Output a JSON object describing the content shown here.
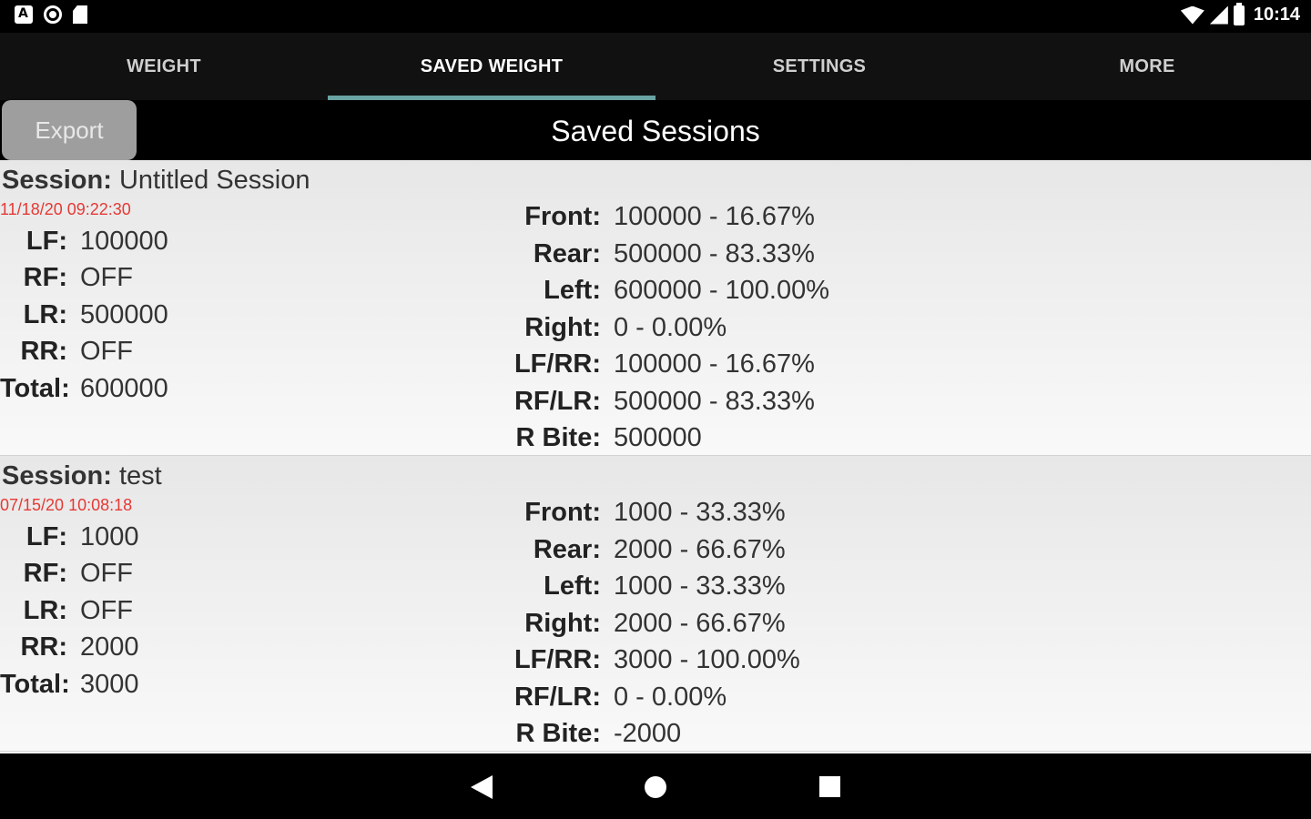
{
  "status_bar": {
    "time": "10:14",
    "left_icons": [
      "a-notification-icon",
      "circle-notification-icon",
      "sd-card-icon"
    ],
    "right_icons": [
      "wifi-icon",
      "signal-icon",
      "battery-icon"
    ]
  },
  "tabs": [
    {
      "label": "WEIGHT",
      "active": false
    },
    {
      "label": "SAVED WEIGHT",
      "active": true
    },
    {
      "label": "SETTINGS",
      "active": false
    },
    {
      "label": "MORE",
      "active": false
    }
  ],
  "accent_color": "#6aa3a3",
  "header": {
    "export_label": "Export",
    "title": "Saved Sessions"
  },
  "sessions": [
    {
      "session_label": "Session:",
      "name": "Untitled Session",
      "date": "11/18/20 09:22:30",
      "left": [
        {
          "k": "LF:",
          "v": "100000"
        },
        {
          "k": "RF:",
          "v": "OFF"
        },
        {
          "k": "LR:",
          "v": "500000"
        },
        {
          "k": "RR:",
          "v": "OFF"
        },
        {
          "k": "Total:",
          "v": "600000"
        }
      ],
      "right": [
        {
          "k": "Front:",
          "v": "100000 - 16.67%"
        },
        {
          "k": "Rear:",
          "v": "500000 - 83.33%"
        },
        {
          "k": "Left:",
          "v": "600000 - 100.00%"
        },
        {
          "k": "Right:",
          "v": "0 - 0.00%"
        },
        {
          "k": "LF/RR:",
          "v": "100000 - 16.67%"
        },
        {
          "k": "RF/LR:",
          "v": "500000 - 83.33%"
        },
        {
          "k": "R Bite:",
          "v": "500000"
        }
      ]
    },
    {
      "session_label": "Session:",
      "name": "test",
      "date": "07/15/20 10:08:18",
      "left": [
        {
          "k": "LF:",
          "v": "1000"
        },
        {
          "k": "RF:",
          "v": "OFF"
        },
        {
          "k": "LR:",
          "v": "OFF"
        },
        {
          "k": "RR:",
          "v": "2000"
        },
        {
          "k": "Total:",
          "v": "3000"
        }
      ],
      "right": [
        {
          "k": "Front:",
          "v": "1000 - 33.33%"
        },
        {
          "k": "Rear:",
          "v": "2000 - 66.67%"
        },
        {
          "k": "Left:",
          "v": "1000 - 33.33%"
        },
        {
          "k": "Right:",
          "v": "2000 - 66.67%"
        },
        {
          "k": "LF/RR:",
          "v": "3000 - 100.00%"
        },
        {
          "k": "RF/LR:",
          "v": "0 - 0.00%"
        },
        {
          "k": "R Bite:",
          "v": "-2000"
        }
      ]
    }
  ],
  "nav_bar": {
    "icons": [
      "back-icon",
      "home-icon",
      "recents-icon"
    ]
  }
}
